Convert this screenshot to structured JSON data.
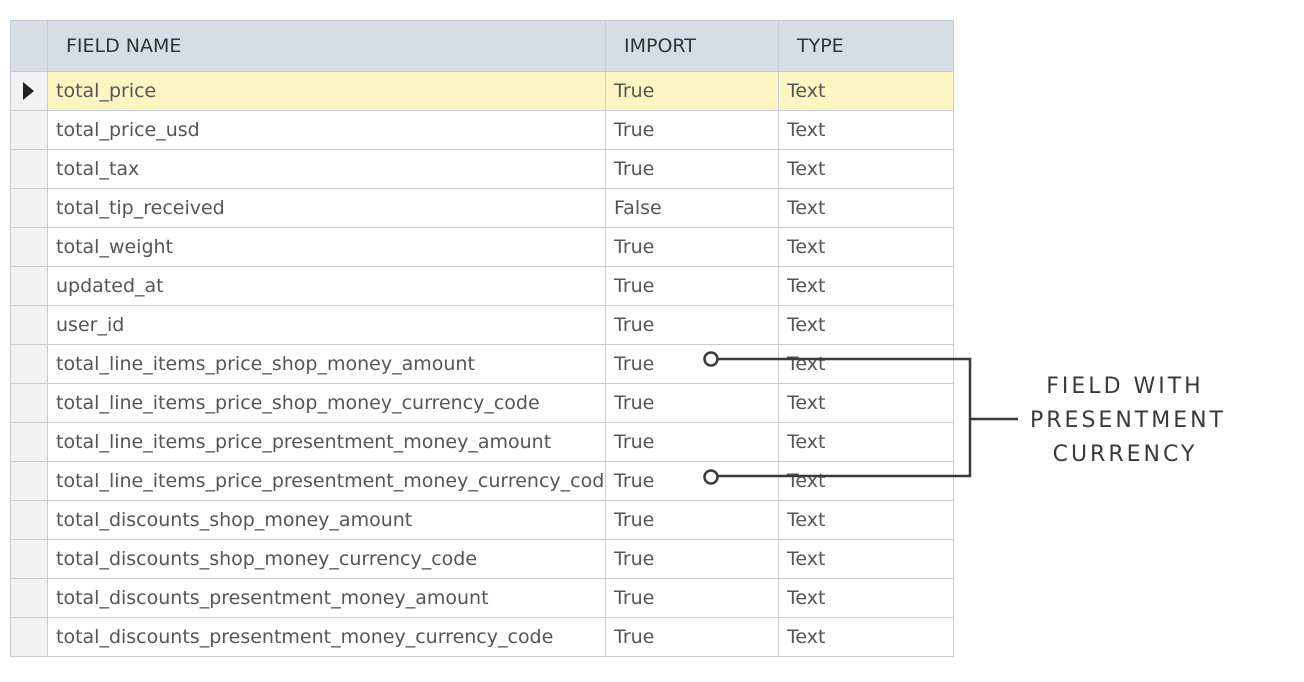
{
  "table": {
    "headers": {
      "field_name": "FIELD NAME",
      "import": "IMPORT",
      "type": "TYPE"
    },
    "current_row_index": 0,
    "rows": [
      {
        "field": "total_price",
        "import": "True",
        "type": "Text"
      },
      {
        "field": "total_price_usd",
        "import": "True",
        "type": "Text"
      },
      {
        "field": "total_tax",
        "import": "True",
        "type": "Text"
      },
      {
        "field": "total_tip_received",
        "import": "False",
        "type": "Text"
      },
      {
        "field": "total_weight",
        "import": "True",
        "type": "Text"
      },
      {
        "field": "updated_at",
        "import": "True",
        "type": "Text"
      },
      {
        "field": "user_id",
        "import": "True",
        "type": "Text"
      },
      {
        "field": "total_line_items_price_shop_money_amount",
        "import": "True",
        "type": "Text"
      },
      {
        "field": "total_line_items_price_shop_money_currency_code",
        "import": "True",
        "type": "Text"
      },
      {
        "field": "total_line_items_price_presentment_money_amount",
        "import": "True",
        "type": "Text"
      },
      {
        "field": "total_line_items_price_presentment_money_currency_code",
        "import": "True",
        "type": "Text"
      },
      {
        "field": "total_discounts_shop_money_amount",
        "import": "True",
        "type": "Text"
      },
      {
        "field": "total_discounts_shop_money_currency_code",
        "import": "True",
        "type": "Text"
      },
      {
        "field": "total_discounts_presentment_money_amount",
        "import": "True",
        "type": "Text"
      },
      {
        "field": "total_discounts_presentment_money_currency_code",
        "import": "True",
        "type": "Text"
      }
    ]
  },
  "callout": {
    "line1": "FIELD WITH",
    "line2": "PRESENTMENT",
    "line3": "CURRENCY"
  },
  "colors": {
    "header_bg": "#d7dde6",
    "current_row_bg": "#fdf6c3",
    "grid_line": "#c7cdd6",
    "callout_line": "#3a3a3a"
  },
  "icons": {
    "row_selector": "triangle-right-icon",
    "callout_endpoint": "circle-icon"
  }
}
